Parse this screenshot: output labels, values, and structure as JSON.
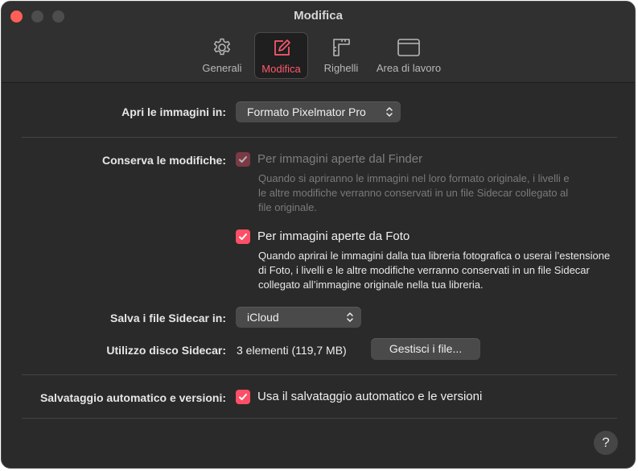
{
  "window": {
    "title": "Modifica"
  },
  "tabs": [
    {
      "label": "Generali",
      "icon": "gear-icon"
    },
    {
      "label": "Modifica",
      "icon": "edit-icon"
    },
    {
      "label": "Righelli",
      "icon": "ruler-icon"
    },
    {
      "label": "Area di lavoro",
      "icon": "window-icon"
    }
  ],
  "accent_color": "#ff4f66",
  "open_images": {
    "label": "Apri le immagini in:",
    "value": "Formato Pixelmator Pro"
  },
  "keep_edits": {
    "label": "Conserva le modifiche:",
    "finder": {
      "label": "Per immagini aperte dal Finder",
      "checked": true,
      "enabled": false,
      "description": "Quando si apriranno le immagini nel loro formato originale, i livelli e le altre modifiche verranno conservati in un file Sidecar collegato al file originale."
    },
    "photos": {
      "label": "Per immagini aperte da Foto",
      "checked": true,
      "enabled": true,
      "description": "Quando aprirai le immagini dalla tua libreria fotografica o userai l’estensione di Foto, i livelli e le altre modifiche verranno conservati in un file Sidecar collegato all’immagine originale nella tua libreria."
    }
  },
  "sidecar_location": {
    "label": "Salva i file Sidecar in:",
    "value": "iCloud"
  },
  "sidecar_usage": {
    "label": "Utilizzo disco Sidecar:",
    "value": "3 elementi (119,7 MB)",
    "button": "Gestisci i file..."
  },
  "autosave": {
    "label": "Salvataggio automatico e versioni:",
    "option": "Usa il salvataggio automatico e le versioni",
    "checked": true
  },
  "help": {
    "label": "?"
  }
}
